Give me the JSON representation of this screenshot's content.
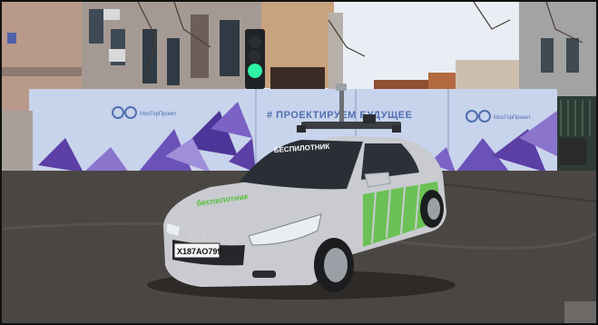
{
  "scene": {
    "fence_banner": {
      "headline": "# ПРОЕКТИРУЕМ БУДУЩЕЕ",
      "logo_text": "МосГорПроект"
    },
    "car": {
      "make_logo": "Hyundai",
      "roof_sign": "БЕСПИЛОТНИК",
      "license_plate": "Х187АО799",
      "door_text": "беспилотник"
    },
    "traffic_light_state": "green"
  },
  "colors": {
    "banner": "#c8d3ec",
    "banner_text": "#4f6fb0",
    "triangle_purple": "#5b3fa5",
    "car_body": "#c9cbd0",
    "car_stripes": "#5bbf3f",
    "signal_green": "#2ef2a4",
    "asphalt": "#4a4643",
    "sky": "#e9eef5"
  }
}
